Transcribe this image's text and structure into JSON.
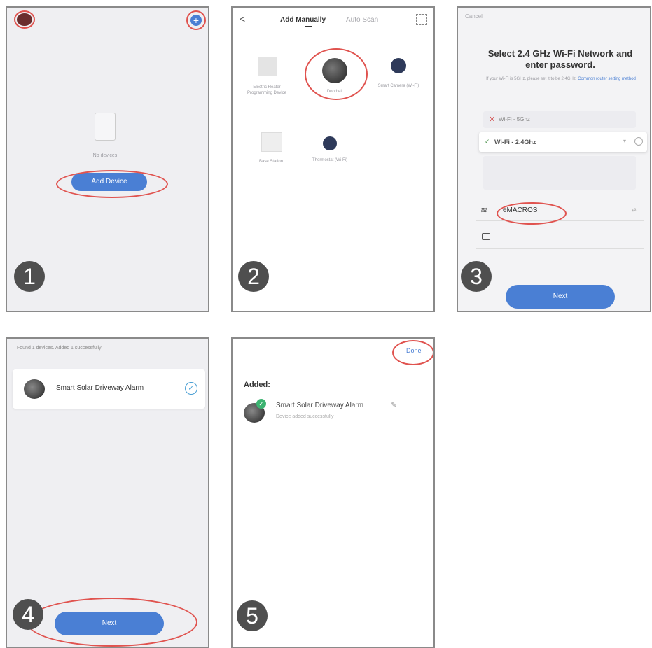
{
  "panel1": {
    "step": "1",
    "empty_text": "No devices",
    "add_device_button": "Add Device"
  },
  "panel2": {
    "step": "2",
    "back_glyph": "<",
    "tab_manual": "Add Manually",
    "tab_auto": "Auto Scan",
    "devices": [
      {
        "label": "Electric Heater Programming Device"
      },
      {
        "label": "Doorbell"
      },
      {
        "label": "Smart Camera (Wi-Fi)"
      },
      {
        "label": "Base Station"
      },
      {
        "label": "Thermostat (Wi-Fi)"
      }
    ]
  },
  "panel3": {
    "step": "3",
    "cancel": "Cancel",
    "title": "Select 2.4 GHz Wi-Fi Network and enter password.",
    "subtitle": "If your Wi-Fi is 5GHz, please set it to be 2.4GHz.",
    "subtitle_link": "Common router setting method",
    "wifi_5g": "Wi-Fi - 5Ghz",
    "wifi_24g": "Wi-Fi - 2.4Ghz",
    "ssid_value": "eMACROS",
    "next_button": "Next"
  },
  "panel4": {
    "step": "4",
    "found_text": "Found 1 devices. Added 1 successfully",
    "device_name": "Smart Solar Driveway Alarm",
    "next_button": "Next"
  },
  "panel5": {
    "step": "5",
    "done": "Done",
    "added_heading": "Added:",
    "device_name": "Smart Solar Driveway Alarm",
    "device_status": "Device added successfully"
  },
  "colors": {
    "accent": "#4a7fd4",
    "highlight_ring": "#e0534f",
    "step_badge": "#4f4f4f"
  }
}
